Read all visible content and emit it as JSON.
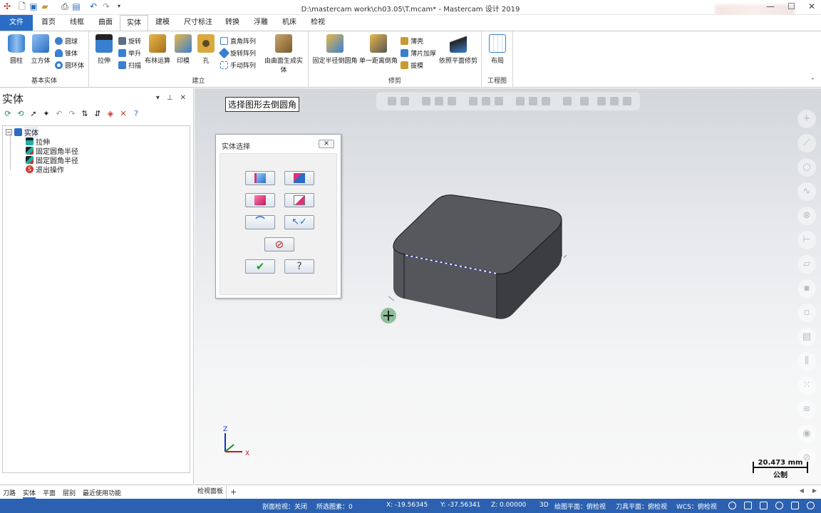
{
  "window": {
    "title": "D:\\mastercam work\\ch03.05\\T.mcam* - Mastercam 设计 2019"
  },
  "tabs": [
    {
      "label": "文件"
    },
    {
      "label": "首页"
    },
    {
      "label": "线框"
    },
    {
      "label": "曲面"
    },
    {
      "label": "实体"
    },
    {
      "label": "建模"
    },
    {
      "label": "尺寸标注"
    },
    {
      "label": "转换"
    },
    {
      "label": "浮雕"
    },
    {
      "label": "机床"
    },
    {
      "label": "检视"
    }
  ],
  "ribbon": {
    "basic_solids": {
      "group_label": "基本实体",
      "cylinder": "圆柱",
      "cube": "立方体",
      "sphere": "圆球",
      "cone": "锥体",
      "torus": "圆环体"
    },
    "create": {
      "group_label": "建立",
      "extrude": "拉伸",
      "revolve": "旋转",
      "loft": "举升",
      "sweep": "扫描",
      "boolean": "布林运算",
      "imprint": "印模",
      "hole": "孔",
      "rect_array": "直角阵列",
      "rotary_array": "旋转阵列",
      "manual_array": "手动阵列",
      "from_surfaces": "由曲面生成实体"
    },
    "modify": {
      "group_label": "修剪",
      "const_fillet": "固定半径倒圆角",
      "single_chamfer": "单一距离倒角",
      "shell": "薄壳",
      "thicken": "薄片加厚",
      "draft": "拔模",
      "trim_plane": "依照平面修剪"
    },
    "drawing": {
      "group_label": "工程图",
      "layout": "布局"
    }
  },
  "left_panel": {
    "title": "实体",
    "tree": {
      "root": "实体",
      "items": [
        "拉伸",
        "固定圆角半径",
        "固定圆角半径",
        "退出操作"
      ]
    },
    "bottom_tabs": [
      "刀路",
      "实体",
      "平面",
      "层别",
      "最近使用功能"
    ]
  },
  "viewport": {
    "prompt": "选择图形去倒圆角",
    "axis": {
      "z": "Z",
      "x": "X"
    },
    "scale": {
      "value": "20.473 mm",
      "unit": "公制"
    },
    "dialog": {
      "title": "实体选择",
      "close": "✕"
    }
  },
  "view_tabs": {
    "active": "检视面板",
    "add": "+"
  },
  "status": {
    "section_view": "剖面检视：关闭",
    "selected": "所选图素：0",
    "x": "X:   -19.56345",
    "y": "Y:   -37.56341",
    "z": "Z:   0.00000",
    "mode": "3D",
    "gview": "绘图平面：俯检视",
    "tplane": "刀具平面：俯检视",
    "wcs": "WCS：俯检视"
  },
  "colors": {
    "accent": "#2b6cc4",
    "status_bg": "#2b61b0",
    "model": "#56575b"
  }
}
